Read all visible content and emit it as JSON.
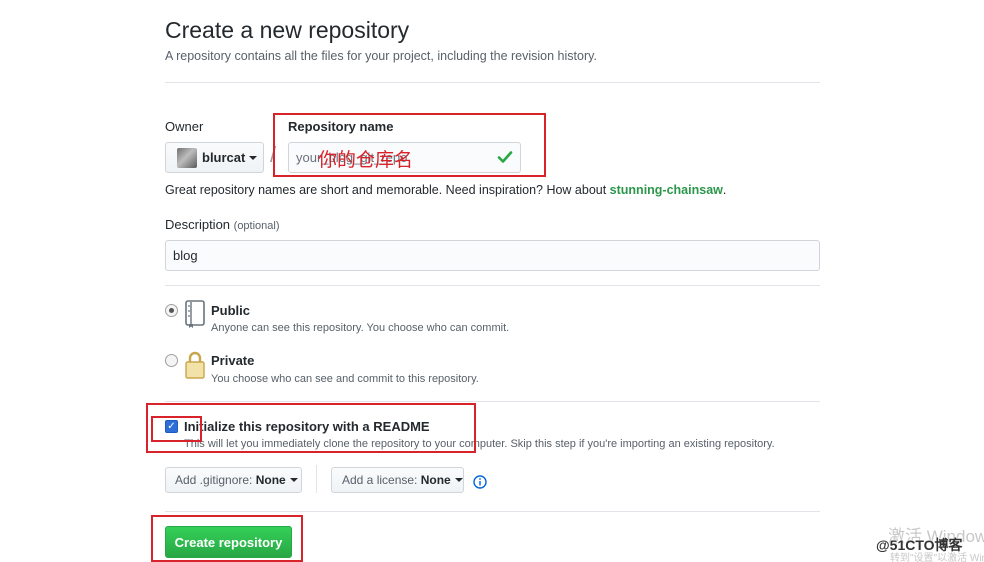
{
  "header": {
    "title": "Create a new repository",
    "subtitle": "A repository contains all the files for your project, including the revision history."
  },
  "owner": {
    "label": "Owner",
    "name": "blurcat"
  },
  "slash": "/",
  "repo_name": {
    "label": "Repository name",
    "value": "your_blog_git_repo",
    "annotation": "你的仓库名",
    "valid_icon": "check-icon"
  },
  "suggestion": {
    "text": "Great repository names are short and memorable. Need inspiration? How about ",
    "name": "stunning-chainsaw",
    "end": "."
  },
  "description": {
    "label": "Description",
    "optional": "(optional)",
    "value": "blog"
  },
  "visibility": {
    "public": {
      "title": "Public",
      "desc": "Anyone can see this repository. You choose who can commit.",
      "selected": true
    },
    "private": {
      "title": "Private",
      "desc": "You choose who can see and commit to this repository.",
      "selected": false
    }
  },
  "readme": {
    "title": "Initialize this repository with a README",
    "desc": "This will let you immediately clone the repository to your computer. Skip this step if you're importing an existing repository.",
    "checked": true
  },
  "gitignore": {
    "prefix": "Add .gitignore:",
    "value": "None"
  },
  "license": {
    "prefix": "Add a license:",
    "value": "None"
  },
  "info_icon": "info-icon",
  "create_button": "Create repository",
  "watermark": {
    "activate": "激活 Windows",
    "activate_sub": "转到\"设置\"以激活 Windows。",
    "site": "@51CTO博客"
  },
  "colors": {
    "accent_green": "#28a745",
    "annotation_red": "#d9232b",
    "link_green": "#2c974b"
  }
}
